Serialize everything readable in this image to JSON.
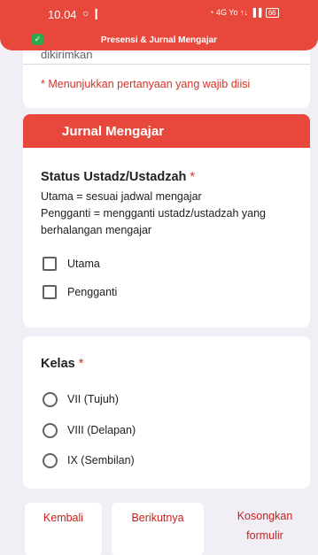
{
  "status_bar": {
    "time": "10.04",
    "left_icons": "○ ❙",
    "right_icons": "◔ 4G Yo ↑↓ ▐▐",
    "battery": "66"
  },
  "app": {
    "title": "Presensi & Jurnal Mengajar"
  },
  "top_card": {
    "cut_text": "dikirimkan",
    "required_note": "* Menunjukkan pertanyaan yang wajib diisi"
  },
  "section": {
    "title": "Jurnal Mengajar",
    "question_title": "Status Ustadz/Ustadzah",
    "required_mark": "*",
    "description_line1": "Utama = sesuai jadwal mengajar",
    "description_line2": "Pengganti = mengganti ustadz/ustadzah yang berhalangan mengajar",
    "options": [
      "Utama",
      "Pengganti"
    ]
  },
  "kelas": {
    "title": "Kelas",
    "required_mark": "*",
    "options": [
      "VII (Tujuh)",
      "VIII (Delapan)",
      "IX (Sembilan)"
    ]
  },
  "buttons": {
    "back": "Kembali",
    "next": "Berikutnya",
    "clear_line1": "Kosongkan",
    "clear_line2": "formulir"
  }
}
